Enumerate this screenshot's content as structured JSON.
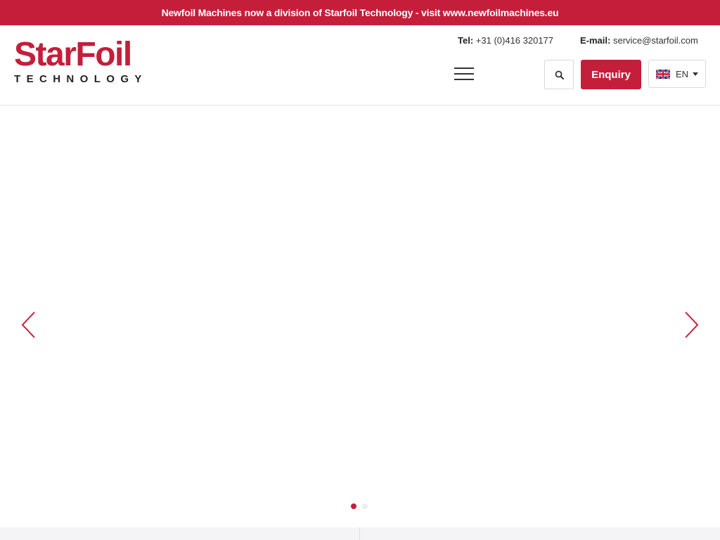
{
  "banner": {
    "text": "Newfoil Machines now a division of Starfoil Technology - visit www.newfoilmachines.eu"
  },
  "logo": {
    "main": "StarFoil",
    "sub": "TECHNOLOGY"
  },
  "contact": {
    "tel_label": "Tel:",
    "tel_value": "+31 (0)416 320177",
    "email_label": "E-mail:",
    "email_value": "service@starfoil.com"
  },
  "header": {
    "enquiry_label": "Enquiry",
    "language": "EN"
  },
  "slider": {
    "slide_count": 2,
    "active_slide": 1
  },
  "colors": {
    "brand_red": "#c41e3a",
    "text_dark": "#222222"
  },
  "icons": {
    "menu": "hamburger-menu-icon",
    "search": "search-icon",
    "flag": "uk-flag-icon",
    "prev": "chevron-left-icon",
    "next": "chevron-right-icon"
  }
}
